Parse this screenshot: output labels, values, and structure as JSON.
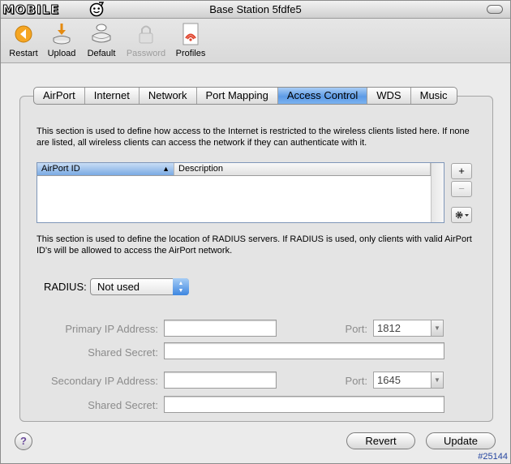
{
  "logo": {
    "text": "MOBILE"
  },
  "window": {
    "title": "Base Station 5fdfe5"
  },
  "toolbar": {
    "items": [
      {
        "label": "Restart",
        "enabled": true
      },
      {
        "label": "Upload",
        "enabled": true
      },
      {
        "label": "Default",
        "enabled": true
      },
      {
        "label": "Password",
        "enabled": false
      },
      {
        "label": "Profiles",
        "enabled": true
      }
    ]
  },
  "tabs": [
    "AirPort",
    "Internet",
    "Network",
    "Port Mapping",
    "Access Control",
    "WDS",
    "Music"
  ],
  "active_tab": "Access Control",
  "access": {
    "description": "This section is used to define how access to the Internet is restricted to the wireless clients listed here. If none are listed, all wireless clients can access the network if they can authenticate with it.",
    "columns": [
      "AirPort ID",
      "Description"
    ],
    "add_label": "+",
    "remove_label": "−",
    "sort_arrow": "▲"
  },
  "radius": {
    "description": "This section is used to define the location of RADIUS servers. If RADIUS is used, only clients with valid AirPort ID's will be allowed to access the AirPort network.",
    "label": "RADIUS:",
    "selected": "Not used",
    "primary_label": "Primary IP Address:",
    "primary_value": "",
    "primary_port_label": "Port:",
    "primary_port": "1812",
    "primary_secret_label": "Shared Secret:",
    "primary_secret": "",
    "secondary_label": "Secondary IP Address:",
    "secondary_value": "",
    "secondary_port_label": "Port:",
    "secondary_port": "1645",
    "secondary_secret_label": "Shared Secret:",
    "secondary_secret": ""
  },
  "buttons": {
    "help": "?",
    "revert": "Revert",
    "update": "Update"
  },
  "watermark": "#25144",
  "colors": {
    "active_tab": "#5d9be6",
    "select_arrow": "#3e86e0"
  }
}
